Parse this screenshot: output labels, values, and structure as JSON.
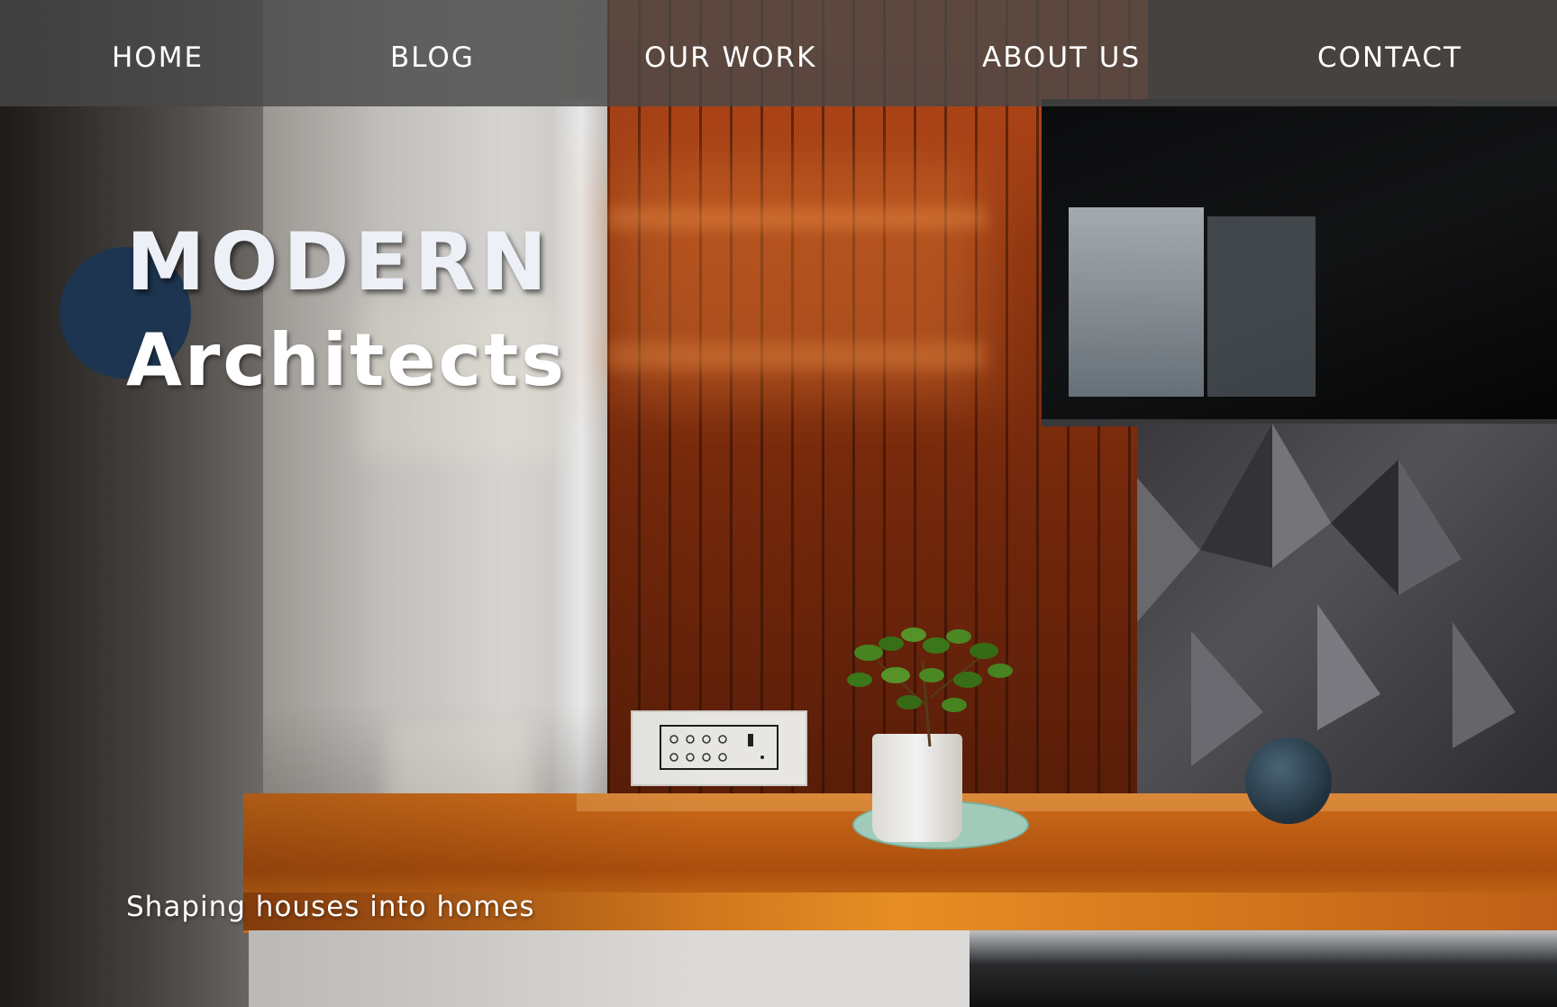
{
  "nav": {
    "items": [
      {
        "label": "HOME"
      },
      {
        "label": "BLOG"
      },
      {
        "label": "OUR WORK"
      },
      {
        "label": "ABOUT US"
      },
      {
        "label": "CONTACT"
      }
    ]
  },
  "hero": {
    "title": "MODERN",
    "subtitle": "Architects",
    "tagline": "Shaping houses into homes"
  },
  "colors": {
    "nav_background": "#484848",
    "accent_dot": "#1d3550",
    "text": "#ffffff"
  }
}
